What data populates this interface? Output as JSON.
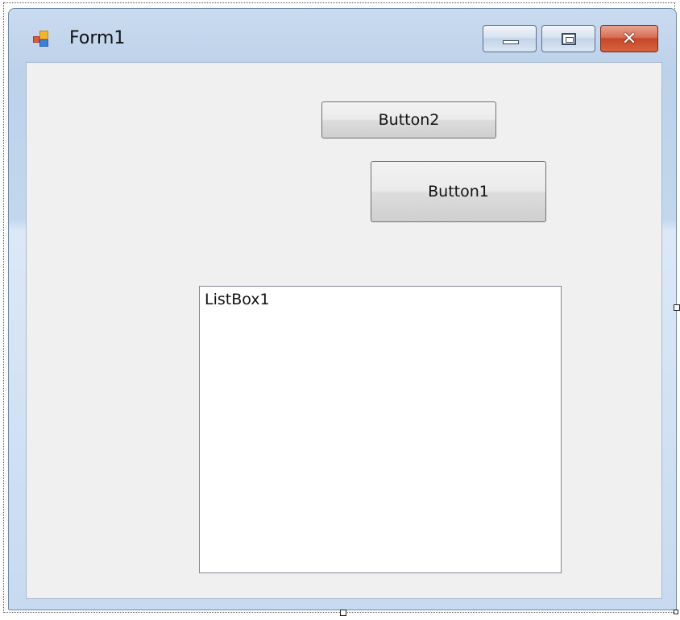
{
  "window": {
    "title": "Form1",
    "icon": "form-app-icon",
    "controls": {
      "minimize_icon": "minimize-icon",
      "maximize_icon": "maximize-icon",
      "close_icon": "close-icon",
      "close_glyph": "✕"
    }
  },
  "form": {
    "button2_label": "Button2",
    "button1_label": "Button1",
    "listbox_label": "ListBox1"
  },
  "colors": {
    "client_background": "#f0f0f0",
    "close_button": "#c7472a",
    "frame": "#c2d6ee"
  }
}
